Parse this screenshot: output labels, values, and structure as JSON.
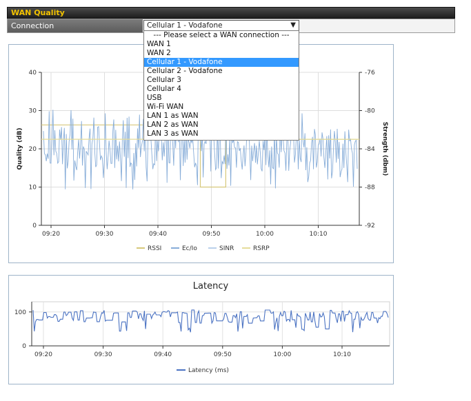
{
  "header": {
    "title": "WAN Quality"
  },
  "connection": {
    "label": "Connection",
    "selected": "Cellular 1 - Vodafone",
    "arrow_icon": "▼",
    "options": [
      "--- Please select a WAN connection ---",
      "WAN 1",
      "WAN 2",
      "Cellular 1 - Vodafone",
      "Cellular 2 - Vodafone",
      "Cellular 3",
      "Cellular 4",
      "USB",
      "Wi-Fi WAN",
      "LAN 1 as WAN",
      "LAN 2 as WAN",
      "LAN 3 as WAN"
    ],
    "selected_index": 3
  },
  "chart_data": [
    {
      "type": "line",
      "title": "",
      "xlabel": "",
      "ylabel": "Quality (dB)",
      "ylabel_right": "Strength (dbm)",
      "x_ticks": [
        "09:20",
        "09:30",
        "09:40",
        "09:50",
        "10:00",
        "10:10"
      ],
      "y_ticks_left": [
        "0",
        "10",
        "20",
        "30",
        "40"
      ],
      "y_ticks_right": [
        "-92",
        "-88",
        "-84",
        "-80",
        "-76"
      ],
      "ylim": [
        0,
        40
      ],
      "ylim_right": [
        -92,
        -76
      ],
      "grid": true,
      "legend_position": "bottom",
      "series": [
        {
          "name": "RSSI",
          "color": "#d6c87a",
          "axis": "right",
          "points": [
            [
              0,
              -81.5
            ],
            [
              50,
              -81.5
            ],
            [
              50,
              -88
            ],
            [
              58,
              -88
            ],
            [
              58,
              -83
            ],
            [
              100,
              -83
            ]
          ]
        },
        {
          "name": "Ec/Io",
          "color": "#86acd8",
          "axis": "left",
          "noisy": true,
          "center": 20,
          "amplitude": 6
        },
        {
          "name": "SINR",
          "color": "#b9d0ea",
          "axis": "left",
          "noisy": false
        },
        {
          "name": "RSRP",
          "color": "#e5dc9a",
          "axis": "right",
          "points": [
            [
              0,
              -83
            ],
            [
              100,
              -83
            ]
          ]
        }
      ]
    },
    {
      "type": "line",
      "title": "Latency",
      "xlabel": "",
      "ylabel": "",
      "x_ticks": [
        "09:20",
        "09:30",
        "09:40",
        "09:50",
        "10:00",
        "10:10"
      ],
      "y_ticks": [
        "0",
        "100"
      ],
      "ylim": [
        0,
        130
      ],
      "grid": true,
      "legend_position": "bottom",
      "series": [
        {
          "name": "Latency (ms)",
          "color": "#4a72c2",
          "noisy": true,
          "center": 78,
          "amplitude": 20
        }
      ]
    }
  ]
}
